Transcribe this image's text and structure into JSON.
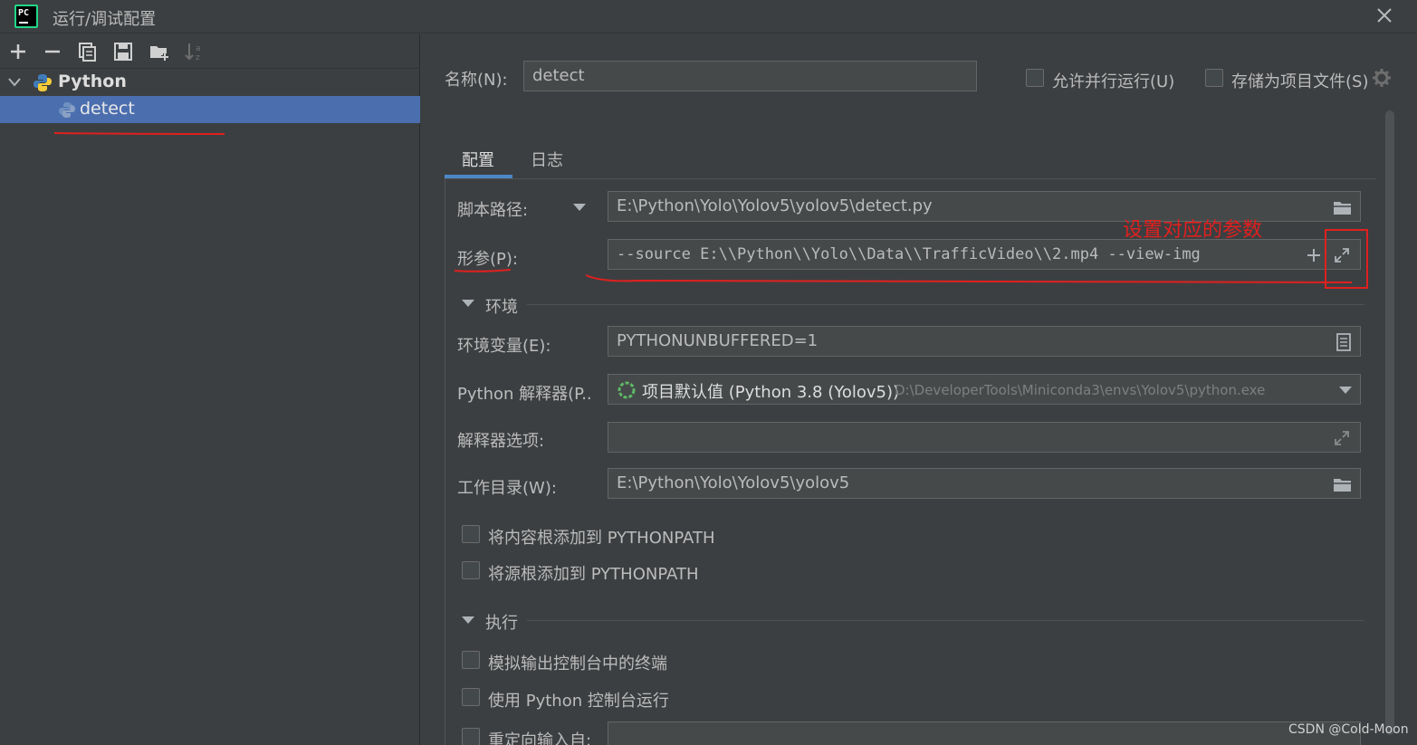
{
  "window": {
    "title": "运行/调试配置"
  },
  "toolbar": {
    "icons": [
      "add-icon",
      "remove-icon",
      "copy-icon",
      "save-icon",
      "folder-add-icon",
      "sort-icon"
    ]
  },
  "tree": {
    "group": "Python",
    "selected_item": "detect"
  },
  "header": {
    "name_label": "名称(N):",
    "name_value": "detect",
    "allow_parallel_label": "允许并行运行(U)",
    "store_as_project_label": "存储为项目文件(S)"
  },
  "tabs": [
    {
      "label": "配置",
      "active": true
    },
    {
      "label": "日志",
      "active": false
    }
  ],
  "config": {
    "script_path_label": "脚本路径:",
    "script_path_value": "E:\\Python\\Yolo\\Yolov5\\yolov5\\detect.py",
    "params_label": "形参(P):",
    "params_value": "--source E:\\\\Python\\\\Yolo\\\\Data\\\\TrafficVideo\\\\2.mp4 --view-img",
    "annotation": "设置对应的参数",
    "env_section": "环境",
    "env_vars_label": "环境变量(E):",
    "env_vars_value": "PYTHONUNBUFFERED=1",
    "interpreter_label": "Python 解释器(P..",
    "interpreter_value": "项目默认值 (Python 3.8 (Yolov5))",
    "interpreter_path": "D:\\DeveloperTools\\Miniconda3\\envs\\Yolov5\\python.exe",
    "interpreter_options_label": "解释器选项:",
    "interpreter_options_value": "",
    "workdir_label": "工作目录(W):",
    "workdir_value": "E:\\Python\\Yolo\\Yolov5\\yolov5",
    "add_content_roots_label": "将内容根添加到 PYTHONPATH",
    "add_source_roots_label": "将源根添加到 PYTHONPATH",
    "exec_section": "执行",
    "emulate_terminal_label": "模拟输出控制台中的终端",
    "python_console_label": "使用 Python 控制台运行",
    "redirect_input_label": "重定向输入自:"
  },
  "watermark": "CSDN @Cold-Moon",
  "colors": {
    "background": "#3c3f41",
    "selection": "#4b6eaf",
    "tab_underline": "#4a88c7",
    "annotation_red": "#e0201f"
  }
}
